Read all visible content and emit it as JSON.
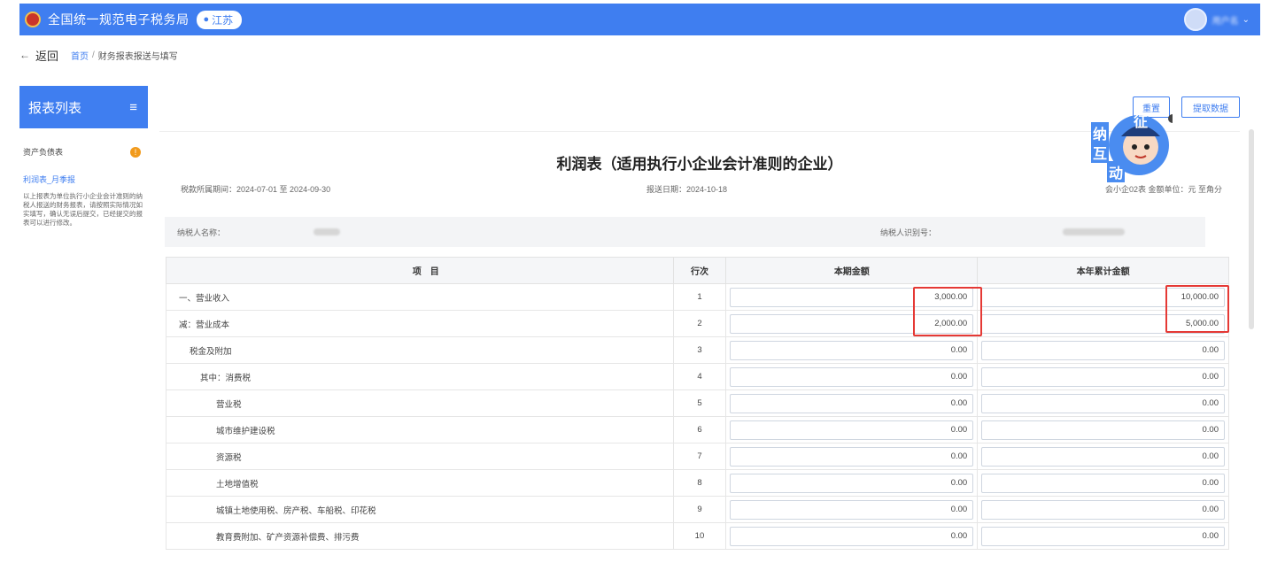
{
  "header": {
    "app_title": "全国统一规范电子税务局",
    "region": "江苏",
    "user_name": "用户名"
  },
  "nav": {
    "back_label": "返回",
    "breadcrumb_home": "首页",
    "breadcrumb_current": "财务报表报送与填写"
  },
  "sidebar": {
    "title": "报表列表",
    "items": [
      {
        "label": "资产负债表",
        "warning": "!"
      },
      {
        "label": "利润表_月季报"
      }
    ],
    "note": "以上报表为单位执行小企业会计准则的纳税人报送的财务报表，请按照实际情况如实填写，确认无误后提交，已经提交的报表可以进行修改。"
  },
  "toolbar": {
    "reset_label": "重置",
    "fetch_label": "提取数据"
  },
  "mascot": {
    "chars": [
      "征",
      "纳",
      "互",
      "动"
    ]
  },
  "report": {
    "title": "利润表（适用执行小企业会计准则的企业）",
    "period_label": "税款所属期间：",
    "period_value": "2024-07-01 至 2024-09-30",
    "fill_date_label": "报送日期：",
    "fill_date_value": "2024-10-18",
    "unit_note": "会小企02表    金额单位：元 至角分",
    "taxpayer_name_label": "纳税人名称：",
    "taxpayer_id_label": "纳税人识别号："
  },
  "table": {
    "headers": [
      "项　目",
      "行次",
      "本期金额",
      "本年累计金额"
    ],
    "rows": [
      {
        "item": "一、营业收入",
        "line": "1",
        "current": "3,000.00",
        "ytd": "10,000.00"
      },
      {
        "item": "减：营业成本",
        "line": "2",
        "current": "2,000.00",
        "ytd": "5,000.00"
      },
      {
        "item": "税金及附加",
        "line": "3",
        "current": "0.00",
        "ytd": "0.00"
      },
      {
        "item": "其中：消费税",
        "line": "4",
        "current": "0.00",
        "ytd": "0.00"
      },
      {
        "item": "营业税",
        "line": "5",
        "current": "0.00",
        "ytd": "0.00"
      },
      {
        "item": "城市维护建设税",
        "line": "6",
        "current": "0.00",
        "ytd": "0.00"
      },
      {
        "item": "资源税",
        "line": "7",
        "current": "0.00",
        "ytd": "0.00"
      },
      {
        "item": "土地增值税",
        "line": "8",
        "current": "0.00",
        "ytd": "0.00"
      },
      {
        "item": "城镇土地使用税、房产税、车船税、印花税",
        "line": "9",
        "current": "0.00",
        "ytd": "0.00"
      },
      {
        "item": "教育费附加、矿产资源补偿费、排污费",
        "line": "10",
        "current": "0.00",
        "ytd": "0.00"
      }
    ]
  },
  "colors": {
    "brand": "#3f7ef0",
    "highlight": "#e53935",
    "warning": "#f19a1c"
  }
}
